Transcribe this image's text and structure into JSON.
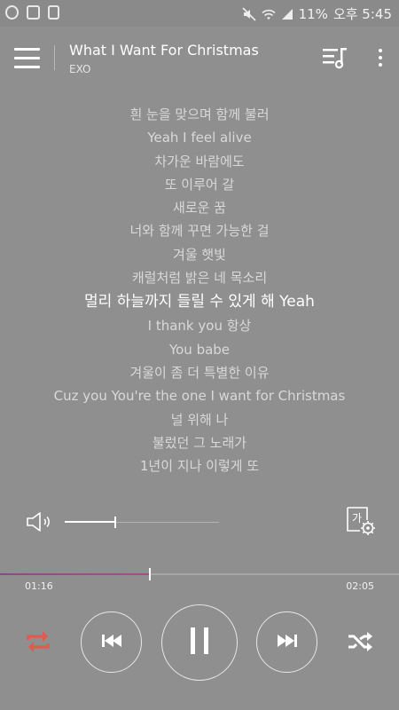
{
  "status_bar": {
    "left_icons": [
      "app-notification-icon",
      "battery-saver-icon",
      "sd-card-icon"
    ],
    "right_icons": [
      "mute-icon",
      "wifi-icon",
      "signal-icon"
    ],
    "battery": "11%",
    "time": "오후 5:45"
  },
  "header": {
    "title": "What I Want For Christmas",
    "artist": "EXO",
    "icons": [
      "menu-icon",
      "playlist-icon",
      "more-icon"
    ]
  },
  "lyrics": [
    "흰 눈을 맞으며 함께 불러",
    "Yeah I feel alive",
    "차가운 바람에도",
    "또 이루어 갈",
    "새로운 꿈",
    "너와 함께 꾸면 가능한 걸",
    "겨울 햇빛",
    "캐럴처럼 밝은 네 목소리",
    "멀리 하늘까지 들릴 수 있게 해 Yeah",
    "I thank you 항상",
    "You babe",
    "겨울이 좀 더 특별한 이유",
    "Cuz you You're the one I want for Christmas",
    "널 위해 나",
    "불렀던 그 노래가",
    "1년이 지나 이렇게 또"
  ],
  "current_lyric_index": 8,
  "volume": {
    "level_percent": 33,
    "icon": "speaker-icon"
  },
  "lyrics_size_button": {
    "label": "가"
  },
  "playback": {
    "elapsed": "01:16",
    "total": "02:05",
    "progress_percent": 37.6
  },
  "controls": {
    "repeat_active": true,
    "icons": [
      "repeat-icon",
      "previous-icon",
      "pause-icon",
      "next-icon",
      "shuffle-icon"
    ]
  },
  "colors": {
    "background": "#8f8f8f",
    "accent_repeat": "#e05a4e",
    "progress_fill": "#9a4d8e",
    "text_primary": "#ffffff",
    "text_secondary": "#d9d9d9"
  }
}
